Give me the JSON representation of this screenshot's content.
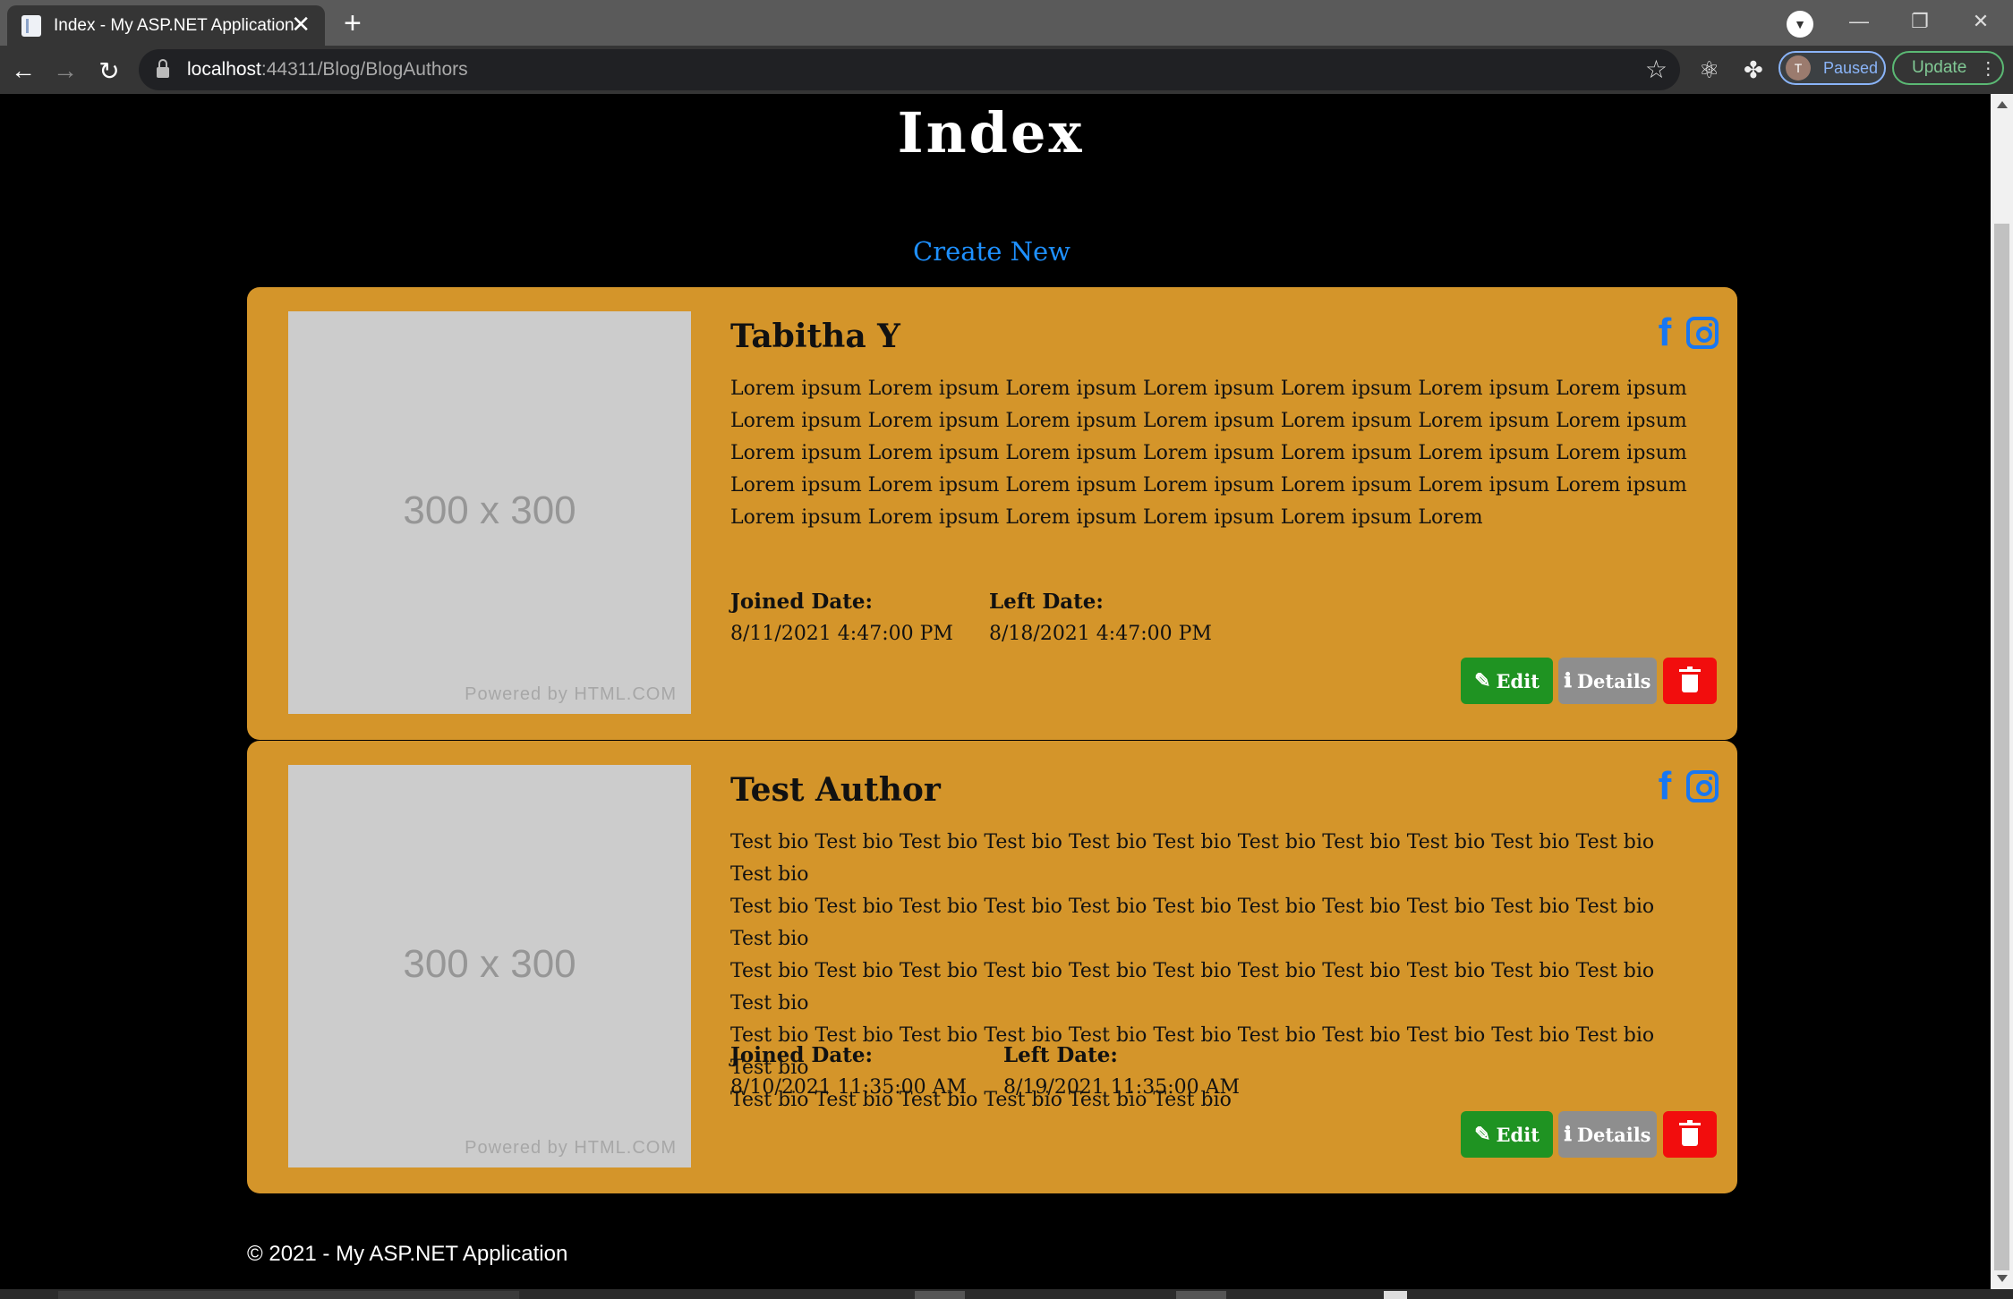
{
  "browser": {
    "tab_title": "Index - My ASP.NET Application",
    "url_host": "localhost",
    "url_rest": ":44311/Blog/BlogAuthors",
    "profile_initial": "T",
    "profile_status": "Paused",
    "update_label": "Update"
  },
  "page": {
    "title": "Index",
    "create_new": "Create New",
    "footer": "© 2021 - My ASP.NET Application"
  },
  "authors": [
    {
      "name": "Tabitha Y",
      "image_text": "300 x 300",
      "image_credit": "Powered by HTML.COM",
      "bio_lines": [
        "Lorem ipsum Lorem ipsum Lorem ipsum Lorem ipsum Lorem ipsum Lorem ipsum Lorem ipsum",
        "Lorem ipsum Lorem ipsum Lorem ipsum Lorem ipsum Lorem ipsum Lorem ipsum Lorem ipsum",
        "Lorem ipsum Lorem ipsum Lorem ipsum Lorem ipsum Lorem ipsum Lorem ipsum Lorem ipsum",
        "Lorem ipsum Lorem ipsum Lorem ipsum Lorem ipsum Lorem ipsum Lorem ipsum Lorem ipsum",
        "Lorem ipsum Lorem ipsum Lorem ipsum Lorem ipsum Lorem ipsum Lorem"
      ],
      "joined_label": "Joined Date:",
      "joined_value": "8/11/2021 4:47:00 PM",
      "left_label": "Left Date:",
      "left_value": "8/18/2021 4:47:00 PM"
    },
    {
      "name": "Test Author",
      "image_text": "300 x 300",
      "image_credit": "Powered by HTML.COM",
      "bio_lines": [
        "Test bio Test bio Test bio Test bio Test bio Test bio Test bio Test bio Test bio Test bio Test bio Test bio",
        "Test bio Test bio Test bio Test bio Test bio Test bio Test bio Test bio Test bio Test bio Test bio Test bio",
        "Test bio Test bio Test bio Test bio Test bio Test bio Test bio Test bio Test bio Test bio Test bio Test bio",
        "Test bio Test bio Test bio Test bio Test bio Test bio Test bio Test bio Test bio Test bio Test bio Test bio",
        "Test bio Test bio Test bio Test bio Test bio Test bio"
      ],
      "joined_label": "Joined Date:",
      "joined_value": "8/10/2021 11:35:00 AM",
      "left_label": "Left Date:",
      "left_value": "8/19/2021 11:35:00 AM"
    }
  ],
  "buttons": {
    "edit": "Edit",
    "details": "Details"
  },
  "icons": {
    "facebook": "facebook-icon",
    "instagram": "instagram-icon",
    "edit": "edit-icon",
    "details": "info-icon",
    "delete": "trash-icon"
  },
  "colors": {
    "card_bg": "#d4952a",
    "link": "#1e90ff",
    "social": "#1877f2",
    "edit_btn": "#1f9322",
    "details_btn": "#8e8e8e",
    "delete_btn": "#f20d0d"
  }
}
